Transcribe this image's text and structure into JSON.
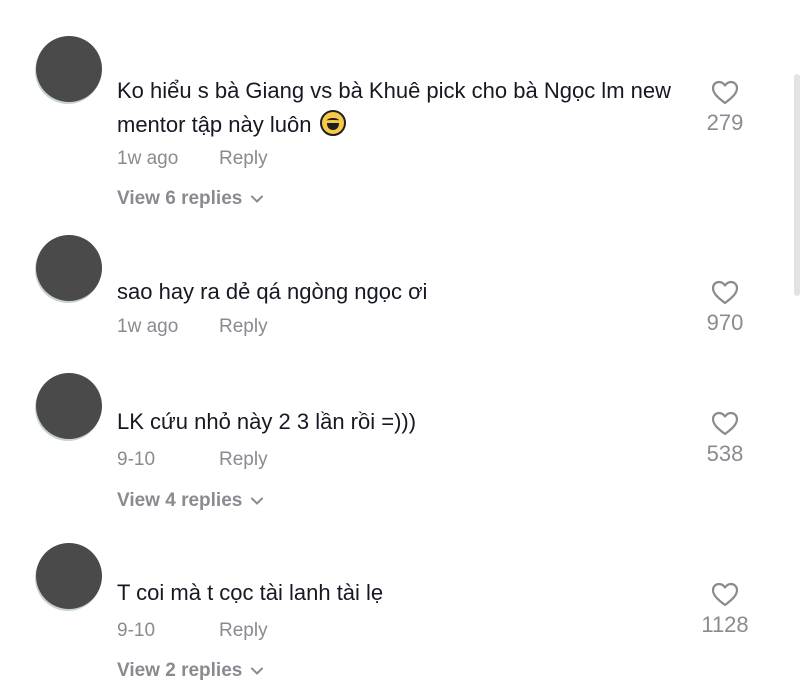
{
  "reply_label": "Reply",
  "comments": [
    {
      "text": "Ko hiểu s bà Giang vs bà Khuê pick cho bà Ngọc lm new mentor tập này luôn",
      "emoji": "grinning-sweat-emoji",
      "time": "1w ago",
      "likes": "279",
      "replies_label": "View 6 replies"
    },
    {
      "text": "sao hay ra dẻ qá ngòng ngọc ơi",
      "time": "1w ago",
      "likes": "970",
      "replies_label": ""
    },
    {
      "text": "LK cứu nhỏ này 2 3 lần rồi =)))",
      "time": "9-10",
      "likes": "538",
      "replies_label": "View 4 replies"
    },
    {
      "text": "T coi mà t cọc tài lanh tài lẹ",
      "time": "9-10",
      "likes": "1128",
      "replies_label": "View 2 replies"
    }
  ],
  "colors": {
    "text": "#161823",
    "muted": "#8a8b91",
    "avatar": "#4a4a4a"
  }
}
